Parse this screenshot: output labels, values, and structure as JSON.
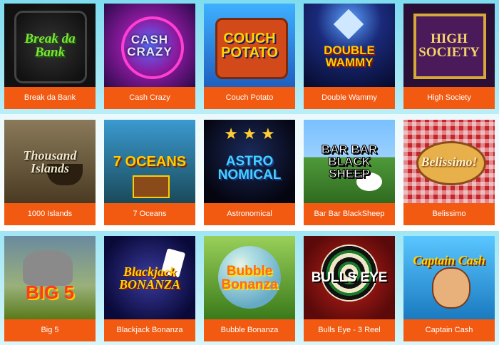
{
  "games": [
    {
      "title": "Break da Bank",
      "logo": "Break da Bank",
      "logo_color": "#7ee23a",
      "bg": "#1a1a1a",
      "icon": "vault-icon"
    },
    {
      "title": "Cash Crazy",
      "logo": "CASH CRAZY",
      "logo_color": "#e8e8ff",
      "bg": "#8b1a9e",
      "icon": "swirl-icon"
    },
    {
      "title": "Couch Potato",
      "logo": "COUCH POTATO",
      "logo_color": "#ffd400",
      "bg": "#2e7fcf",
      "icon": "tv-icon"
    },
    {
      "title": "Double Wammy",
      "logo": "DOUBLE WAMMY",
      "logo_color": "#ffcc00",
      "bg": "#0f1a4a",
      "icon": "diamond-icon"
    },
    {
      "title": "High Society",
      "logo": "HIGH SOCIETY",
      "logo_color": "#f4d36b",
      "bg": "#3b1a4a",
      "icon": "frame-icon"
    },
    {
      "title": "1000 Islands",
      "logo": "Thousand Islands",
      "logo_color": "#f0e6c8",
      "bg": "#6b5a3a",
      "icon": "ship-icon"
    },
    {
      "title": "7 Oceans",
      "logo": "7 OCEANS",
      "logo_color": "#ffcc00",
      "bg": "#1f5f7a",
      "icon": "treasure-icon"
    },
    {
      "title": "Astronomical",
      "logo": "ASTRO NOMICAL",
      "logo_color": "#43d1ff",
      "bg": "#0a0a20",
      "icon": "stars-icon"
    },
    {
      "title": "Bar Bar BlackSheep",
      "logo": "BAR BAR BLACK SHEEP",
      "logo_color": "#ffffff",
      "bg": "#4f9a3a",
      "icon": "sheep-icon"
    },
    {
      "title": "Belissimo",
      "logo": "Belissimo!",
      "logo_color": "#fff4c0",
      "bg": "#c8252b",
      "icon": "chef-icon"
    },
    {
      "title": "Big 5",
      "logo": "BIG 5",
      "logo_color": "#ff3b1a",
      "bg": "#7a9a2a",
      "icon": "elephant-icon"
    },
    {
      "title": "Blackjack Bonanza",
      "logo": "Blackjack BONANZA",
      "logo_color": "#ffd400",
      "bg": "#1a1a6a",
      "icon": "cards-icon"
    },
    {
      "title": "Bubble Bonanza",
      "logo": "Bubble Bonanza",
      "logo_color": "#ff6a1a",
      "bg": "#5f9a2a",
      "icon": "bubble-icon"
    },
    {
      "title": "Bulls Eye - 3 Reel",
      "logo": "BULLS EYE",
      "logo_color": "#ffffff",
      "bg": "#8a0f12",
      "icon": "dartboard-icon"
    },
    {
      "title": "Captain Cash",
      "logo": "Captain Cash",
      "logo_color": "#ffd400",
      "bg": "#3aa6e0",
      "icon": "pirate-icon"
    }
  ]
}
